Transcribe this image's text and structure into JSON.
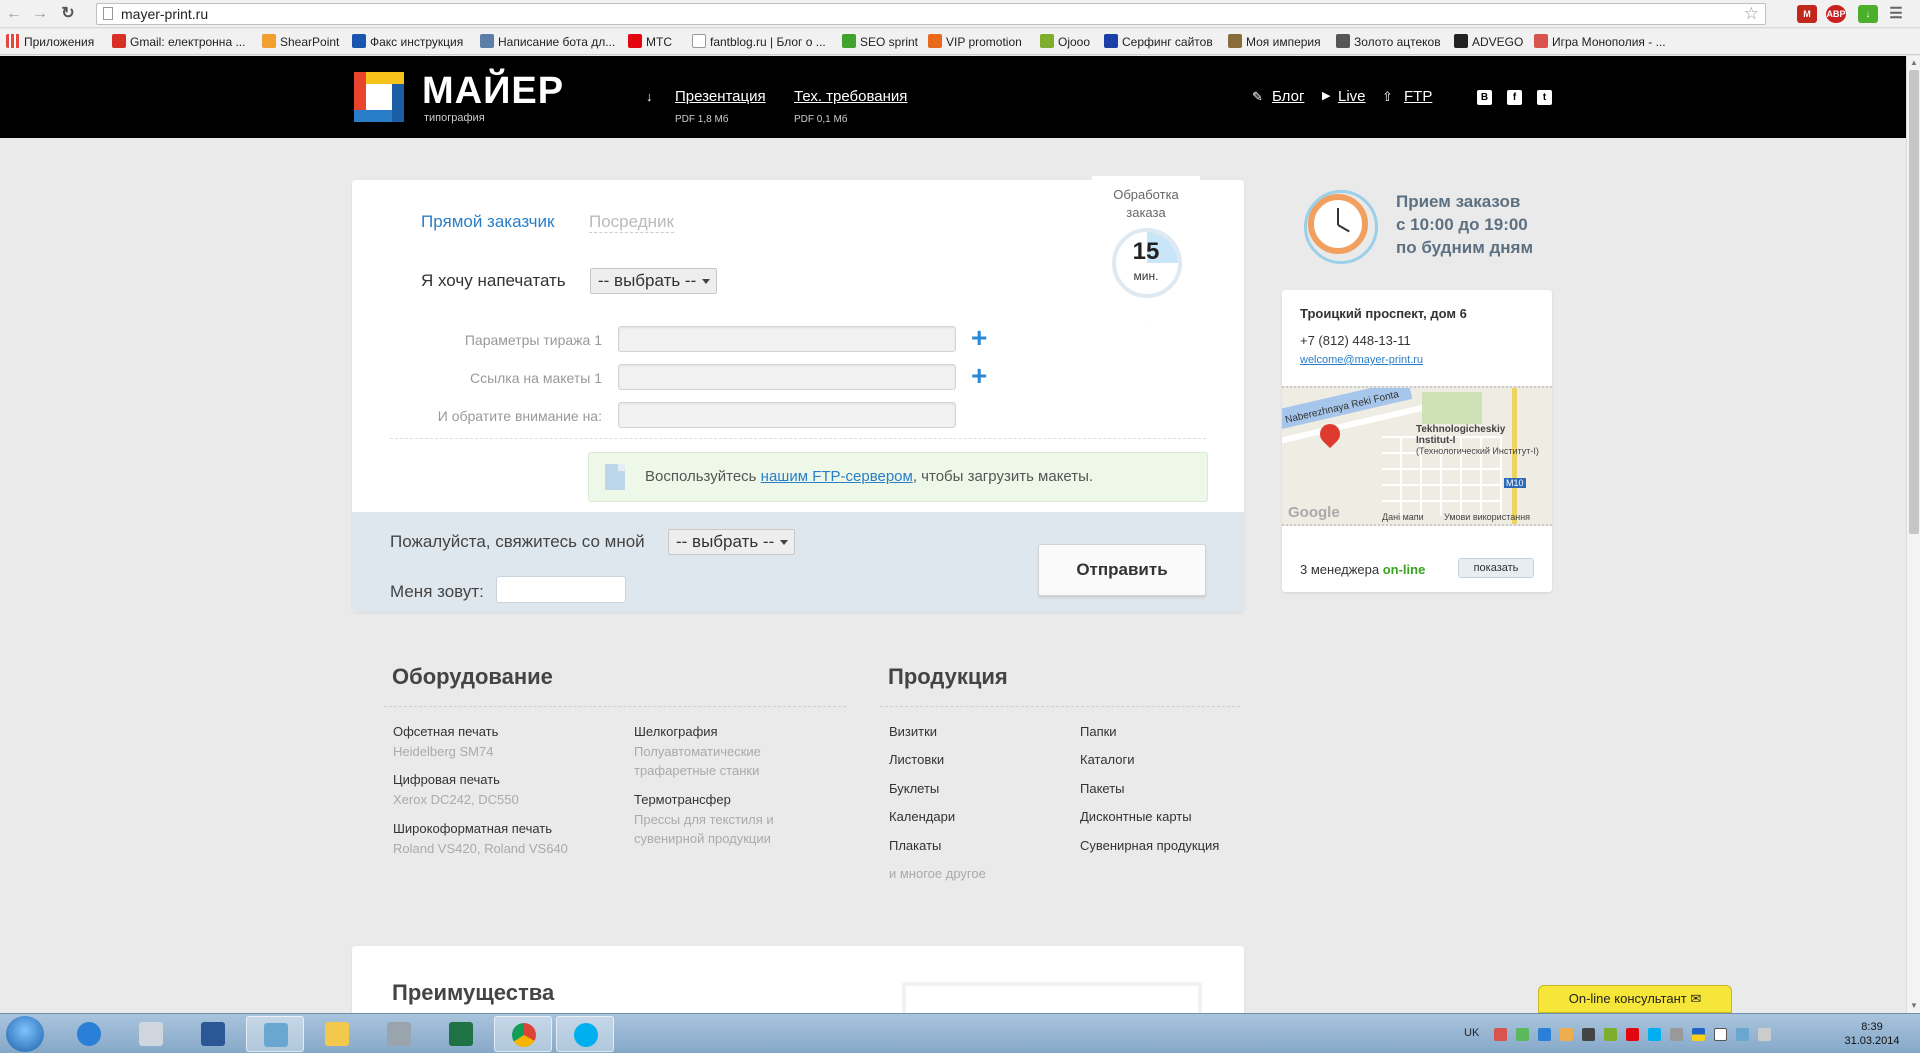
{
  "browser": {
    "url": "mayer-print.ru",
    "bookmarks": [
      {
        "label": "Приложения",
        "icon": "apps-grid-icon",
        "color": "#e8453c"
      },
      {
        "label": "Gmail: електронна ...",
        "icon": "gmail-icon",
        "color": "#d93025"
      },
      {
        "label": "ShearPoint",
        "icon": "shearpoint-icon",
        "color": "#f0a030"
      },
      {
        "label": "Факс инструкция",
        "icon": "arrow-right-icon",
        "color": "#1a56b0"
      },
      {
        "label": "Написание бота дл...",
        "icon": "h-icon",
        "color": "#5b7fa8"
      },
      {
        "label": "МТС",
        "icon": "mts-icon",
        "color": "#e30611"
      },
      {
        "label": "fantblog.ru | Блог о ...",
        "icon": "page-icon",
        "color": "#999999"
      },
      {
        "label": "SEO sprint",
        "icon": "seo-sprint-icon",
        "color": "#3fa32c"
      },
      {
        "label": "VIP promotion",
        "icon": "vip-promotion-icon",
        "color": "#e86a1a"
      },
      {
        "label": "Ojooo",
        "icon": "ojooo-icon",
        "color": "#7fae2c"
      },
      {
        "label": "Серфинг сайтов",
        "icon": "r-icon",
        "color": "#1b3fa8"
      },
      {
        "label": "Моя империя",
        "icon": "empire-icon",
        "color": "#8a6b3a"
      },
      {
        "label": "Золото ацтеков",
        "icon": "aztec-icon",
        "color": "#555555"
      },
      {
        "label": "ADVEGO",
        "icon": "advego-icon",
        "color": "#222222"
      },
      {
        "label": "Игра Монополия - ...",
        "icon": "monopoly-icon",
        "color": "#d9534f"
      }
    ]
  },
  "header": {
    "logo": "МАЙЕР",
    "logo_sub": "типография",
    "presentation": {
      "label": "Презентация",
      "sub": "PDF 1,8 Мб"
    },
    "tech": {
      "label": "Тех. требования",
      "sub": "PDF 0,1 Мб"
    },
    "blog": "Блог",
    "live": "Live",
    "ftp": "FTP",
    "social": [
      "В",
      "f",
      "t"
    ]
  },
  "form": {
    "tab_direct": "Прямой заказчик",
    "tab_mediator": "Посредник",
    "want_label": "Я хочу напечатать",
    "want_select": "-- выбрать --",
    "fields": [
      {
        "label": "Параметры тиража 1",
        "plus": "+"
      },
      {
        "label": "Ссылка на макеты 1",
        "plus": "+"
      },
      {
        "label": "И обратите внимание на:",
        "plus": ""
      }
    ],
    "ftp_note_before": "Воспользуйтесь ",
    "ftp_note_link": "нашим FTP-сервером",
    "ftp_note_after": ", чтобы загрузить макеты.",
    "contact_label": "Пожалуйста, свяжитесь со мной",
    "contact_select": "-- выбрать --",
    "name_label": "Меня зовут:",
    "send": "Отправить"
  },
  "badge": {
    "title": "Обработка заказа",
    "number": "15",
    "unit": "мин."
  },
  "hours": [
    "Прием заказов",
    "с 10:00 до 19:00",
    "по будним дням"
  ],
  "address": {
    "street": "Троицкий проспект, дом 6",
    "phone": "+7 (812) 448-13-11",
    "email": "welcome@mayer-print.ru",
    "map_labels": {
      "river": "Naberezhnaya Reki Fonta",
      "place": "Tekhnologicheskiy Institut-I",
      "place_ru": "(Технологический Институт-I)",
      "road": "M10",
      "google": "Google",
      "data": "Дані мапи",
      "terms": "Умови використання"
    },
    "managers_prefix": "3 менеджера ",
    "managers_online": "on-line",
    "show": "показать"
  },
  "equipment": {
    "title": "Оборудование",
    "items": [
      {
        "name": "Офсетная печать",
        "sub": "Heidelberg SM74"
      },
      {
        "name": "Цифровая печать",
        "sub": "Xerox DC242, DC550"
      },
      {
        "name": "Широкоформатная печать",
        "sub": "Roland VS420, Roland VS640"
      },
      {
        "name": "Шелкография",
        "sub": "Полуавтоматические трафаретные станки"
      },
      {
        "name": "Термотрансфер",
        "sub": "Прессы для текстиля и сувенирной продукции"
      }
    ]
  },
  "products": {
    "title": "Продукция",
    "col1": [
      "Визитки",
      "Листовки",
      "Буклеты",
      "Календари",
      "Плакаты"
    ],
    "col2": [
      "Папки",
      "Каталоги",
      "Пакеты",
      "Дисконтные карты",
      "Сувенирная продукция"
    ],
    "more": "и многое другое"
  },
  "benefits": {
    "title": "Преимущества"
  },
  "consultant": "On-line консультант",
  "taskbar": {
    "lang": "UK",
    "time": "8:39",
    "date": "31.03.2014"
  }
}
